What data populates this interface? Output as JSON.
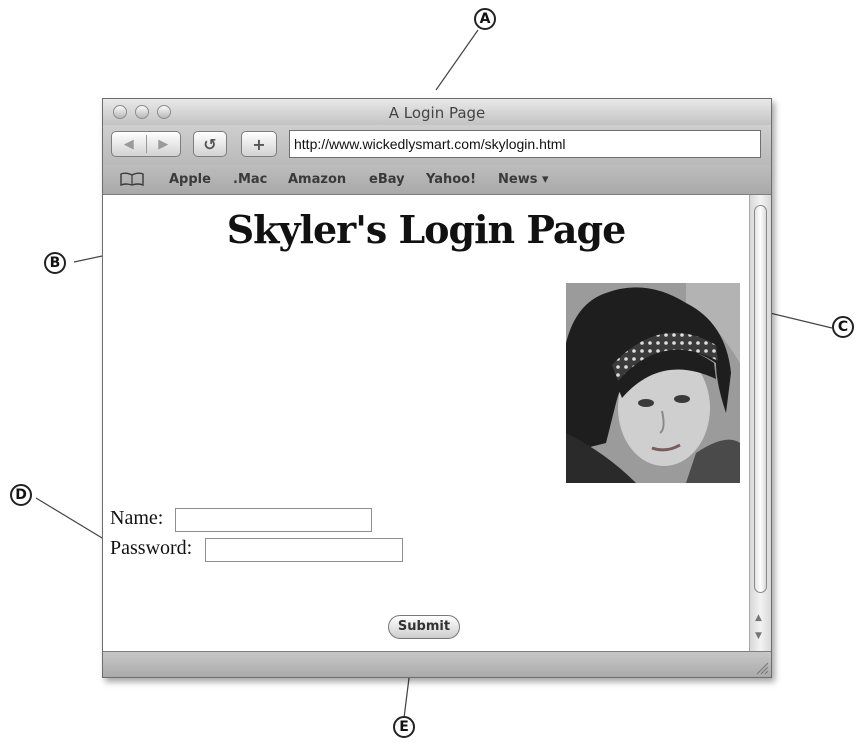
{
  "callouts": {
    "a": "A",
    "b": "B",
    "c": "C",
    "d": "D",
    "e": "E"
  },
  "window": {
    "title": "A Login Page"
  },
  "toolbar": {
    "back_glyph": "◀",
    "forward_glyph": "▶",
    "reload_glyph": "↺",
    "add_glyph": "+",
    "url": "http://www.wickedlysmart.com/skylogin.html"
  },
  "bookmarks": [
    "Apple",
    ".Mac",
    "Amazon",
    "eBay",
    "Yahoo!",
    "News ▾"
  ],
  "page": {
    "heading": "Skyler's Login Page",
    "name_label": "Name:",
    "password_label": "Password:",
    "name_value": "",
    "password_value": "",
    "submit_label": "Submit"
  },
  "icons": {
    "bookmarks": "book-icon",
    "reload": "reload-icon",
    "add": "add-bookmark-icon",
    "resize": "resize-grip-icon"
  }
}
